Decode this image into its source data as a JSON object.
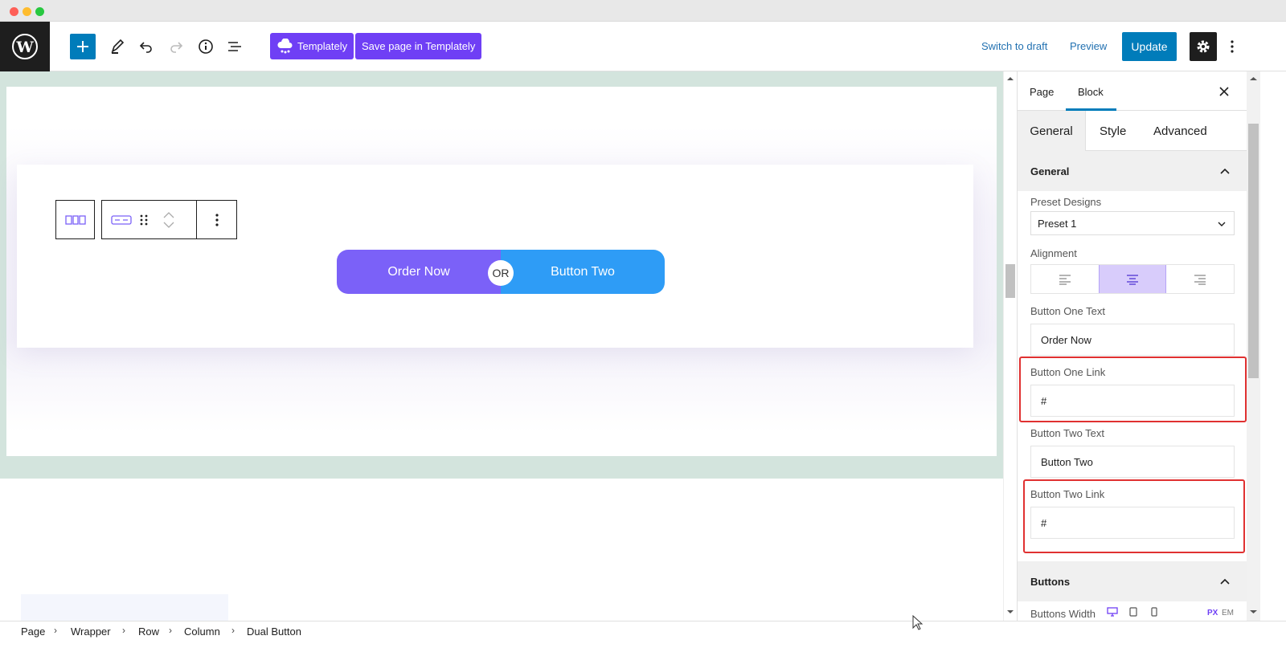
{
  "toolbar": {
    "templately_label": "Templately",
    "save_templately_label": "Save page in Templately",
    "switch_to_draft": "Switch to draft",
    "preview": "Preview",
    "update": "Update"
  },
  "canvas": {
    "button_one": "Order Now",
    "or_label": "OR",
    "button_two": "Button Two"
  },
  "sidebar": {
    "tabs": [
      "Page",
      "Block"
    ],
    "active_tab": "Block",
    "subtabs": [
      "General",
      "Style",
      "Advanced"
    ],
    "active_subtab": "General",
    "general_section": "General",
    "preset_label": "Preset Designs",
    "preset_value": "Preset 1",
    "alignment_label": "Alignment",
    "alignment_selected": "center",
    "button_one_text_label": "Button One Text",
    "button_one_text_value": "Order Now",
    "button_one_link_label": "Button One Link",
    "button_one_link_value": "#",
    "button_two_text_label": "Button Two Text",
    "button_two_text_value": "Button Two",
    "button_two_link_label": "Button Two Link",
    "button_two_link_value": "#",
    "buttons_section": "Buttons",
    "buttons_width_label": "Buttons Width",
    "unit_px": "PX",
    "unit_em": "EM"
  },
  "breadcrumb": [
    "Page",
    "Wrapper",
    "Row",
    "Column",
    "Dual Button"
  ],
  "colors": {
    "accent": "#007cba",
    "templately": "#6f3ff5",
    "button_one": "#7b61f8",
    "button_two": "#2e9cf6",
    "highlight": "#e03131",
    "band": "#d3e4dd"
  }
}
